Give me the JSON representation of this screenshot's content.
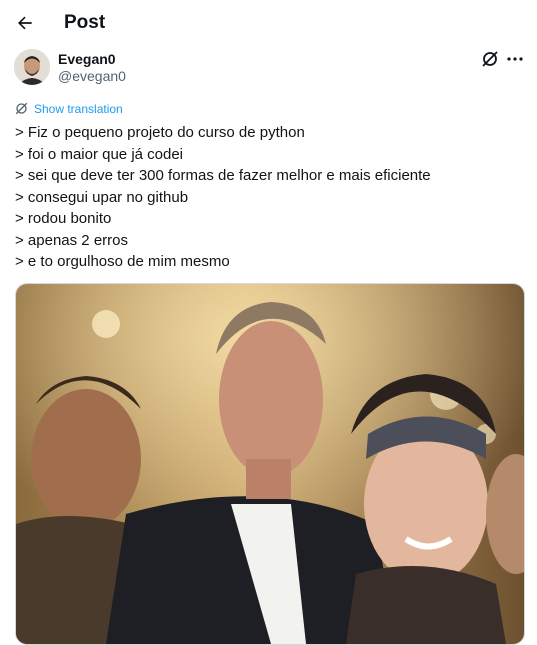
{
  "header": {
    "title": "Post",
    "back_icon": "arrow-left-icon"
  },
  "author": {
    "name": "Evegan0",
    "handle": "@evegan0"
  },
  "actions": {
    "grok_icon": "grok-icon",
    "more_icon": "more-dots-icon"
  },
  "translation": {
    "label": "Show translation",
    "icon": "translate-icon"
  },
  "tweet": {
    "lines": [
      "> Fiz o pequeno projeto do curso de python",
      "> foi o maior que já codei",
      "> sei que deve ter 300 formas de fazer melhor e mais eficiente",
      "> consegui upar no github",
      "> rodou bonito",
      "> apenas 2 erros",
      "> e to orgulhoso de mim mesmo"
    ]
  },
  "media": {
    "type": "gif"
  },
  "colors": {
    "accent": "#1d9bf0",
    "secondary_text": "#536471",
    "text": "#0f1419"
  }
}
